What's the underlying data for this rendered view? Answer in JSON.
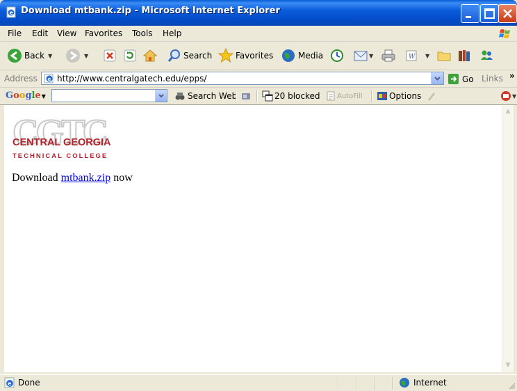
{
  "window": {
    "title": "Download mtbank.zip - Microsoft Internet Explorer"
  },
  "menu": [
    "File",
    "Edit",
    "View",
    "Favorites",
    "Tools",
    "Help"
  ],
  "toolbar": {
    "back_label": "Back",
    "search_label": "Search",
    "favorites_label": "Favorites",
    "media_label": "Media"
  },
  "address": {
    "label": "Address",
    "url": "http://www.centralgatech.edu/epps/",
    "go_label": "Go",
    "links_label": "Links",
    "more_chevron": "»"
  },
  "google_bar": {
    "logo": "Google",
    "search_web_label": "Search Web",
    "blocked_label": "20 blocked",
    "autofill_label": "AutoFill",
    "options_label": "Options"
  },
  "page": {
    "logo_main": "CENTRAL GEORGIA",
    "logo_sub": "TECHNICAL COLLEGE",
    "download_prefix": "Download",
    "download_link": "mtbank.zip",
    "download_suffix": "now"
  },
  "status": {
    "text": "Done",
    "zone": "Internet"
  },
  "colors": {
    "title_bar": "#0A5CDB",
    "chrome": "#ECE9D8",
    "link": "#0000FF",
    "logo_red": "#B2232C"
  }
}
